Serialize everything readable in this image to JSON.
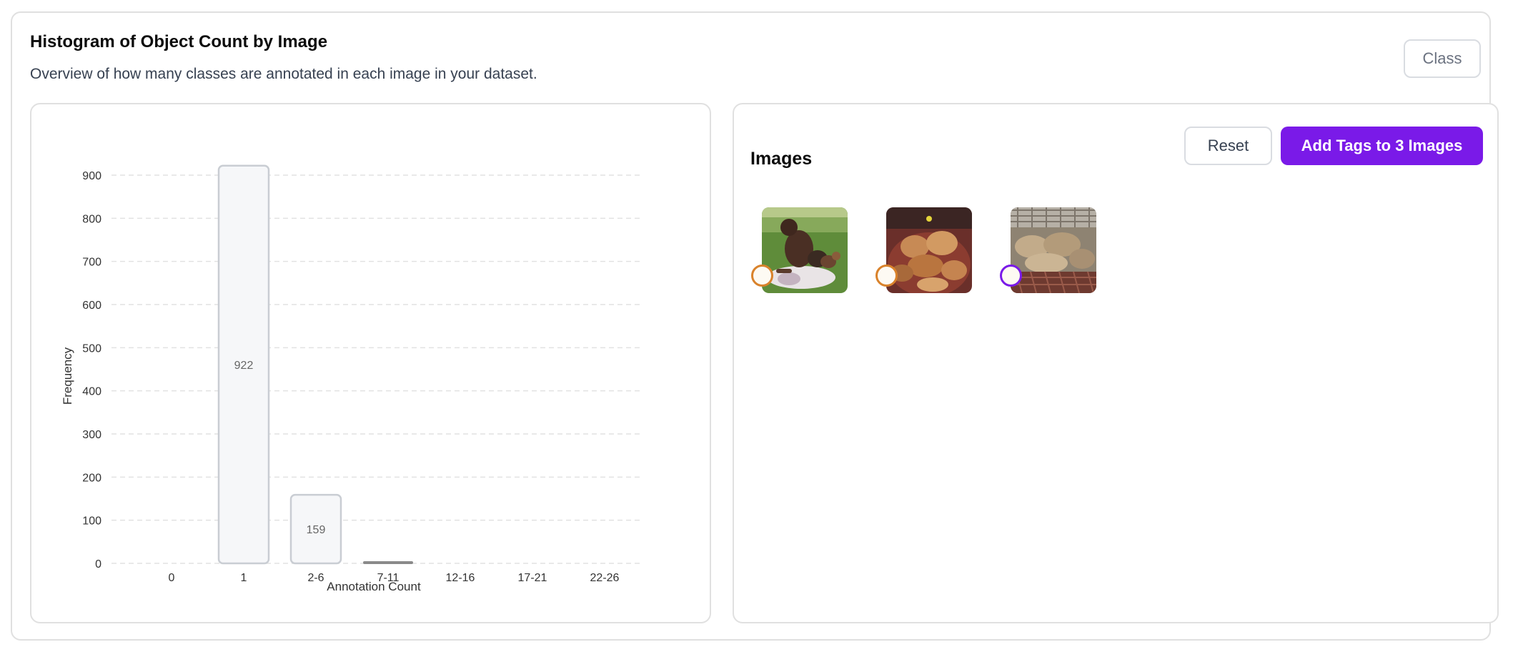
{
  "header": {
    "title": "Histogram of Object Count by Image",
    "subtitle": "Overview of how many classes are annotated in each image in your dataset.",
    "class_button": "Class"
  },
  "chart_data": {
    "type": "bar",
    "categories": [
      "0",
      "1",
      "2-6",
      "7-11",
      "12-16",
      "17-21",
      "22-26"
    ],
    "values": [
      0,
      922,
      159,
      4,
      0,
      0,
      0
    ],
    "data_labels": [
      "",
      "922",
      "159",
      "",
      "",
      "",
      ""
    ],
    "xlabel": "Annotation Count",
    "ylabel": "Frequency",
    "ylim": [
      0,
      900
    ],
    "yticks": [
      "0",
      "100",
      "200",
      "300",
      "400",
      "500",
      "600",
      "700",
      "800",
      "900"
    ],
    "grid": true
  },
  "images_panel": {
    "title": "Images",
    "reset_label": "Reset",
    "add_tags_label": "Add Tags to 3 Images",
    "images": [
      {
        "name": "dog-on-grass",
        "check_color": "#d9822b"
      },
      {
        "name": "puppies-in-basket",
        "check_color": "#d9822b"
      },
      {
        "name": "puppies-in-kennel",
        "check_color": "#7a1ae8"
      }
    ]
  },
  "colors": {
    "accent": "#7a1ae8",
    "bar_fill": "#f6f7f9",
    "bar_stroke": "#c9cdd3",
    "grid": "#e2e2e2"
  }
}
